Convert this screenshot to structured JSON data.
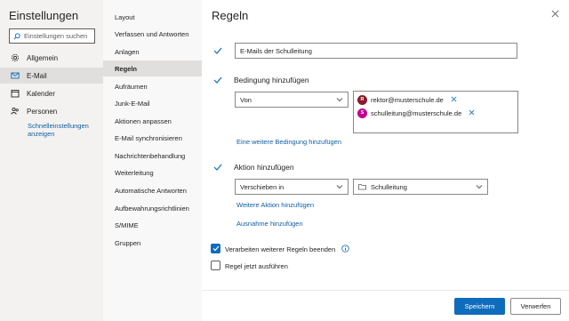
{
  "settings": {
    "title": "Einstellungen",
    "search_placeholder": "Einstellungen suchen",
    "categories": [
      {
        "label": "Allgemein",
        "icon": "gear-icon"
      },
      {
        "label": "E-Mail",
        "icon": "mail-icon",
        "active": true
      },
      {
        "label": "Kalender",
        "icon": "calendar-icon"
      },
      {
        "label": "Personen",
        "icon": "people-icon"
      }
    ],
    "quick_settings_label": "Schnelleinstellungen anzeigen"
  },
  "mail_nav": {
    "items": [
      "Layout",
      "Verfassen und Antworten",
      "Anlagen",
      "Regeln",
      "Aufräumen",
      "Junk-E-Mail",
      "Aktionen anpassen",
      "E-Mail synchronisieren",
      "Nachrichtenbehandlung",
      "Weiterleitung",
      "Automatische Antworten",
      "Aufbewahrungsrichtlinien",
      "S/MIME",
      "Gruppen"
    ],
    "active": "Regeln"
  },
  "rule": {
    "page_title": "Regeln",
    "name_value": "E-Mails der Schulleitung",
    "condition_label": "Bedingung hinzufügen",
    "condition_select": "Von",
    "recipients": [
      {
        "initial": "R",
        "email": "rektor@musterschule.de",
        "color": "#8b1a2b"
      },
      {
        "initial": "S",
        "email": "schulleitung@musterschule.de",
        "color": "#c3008f"
      }
    ],
    "add_condition_link": "Eine weitere Bedingung hinzufügen",
    "action_label": "Aktion hinzufügen",
    "action_select": "Verschieben in",
    "folder_select": "Schulleitung",
    "add_action_link": "Weitere Aktion hinzufügen",
    "add_exception_link": "Ausnahme hinzufügen",
    "stop_processing_label": "Verarbeiten weiterer Regeln beenden",
    "stop_processing_checked": true,
    "run_now_label": "Regel jetzt ausführen",
    "run_now_checked": false,
    "save_label": "Speichern",
    "discard_label": "Verwerfen"
  },
  "colors": {
    "accent": "#0f6cbd",
    "link": "#115ea3"
  }
}
